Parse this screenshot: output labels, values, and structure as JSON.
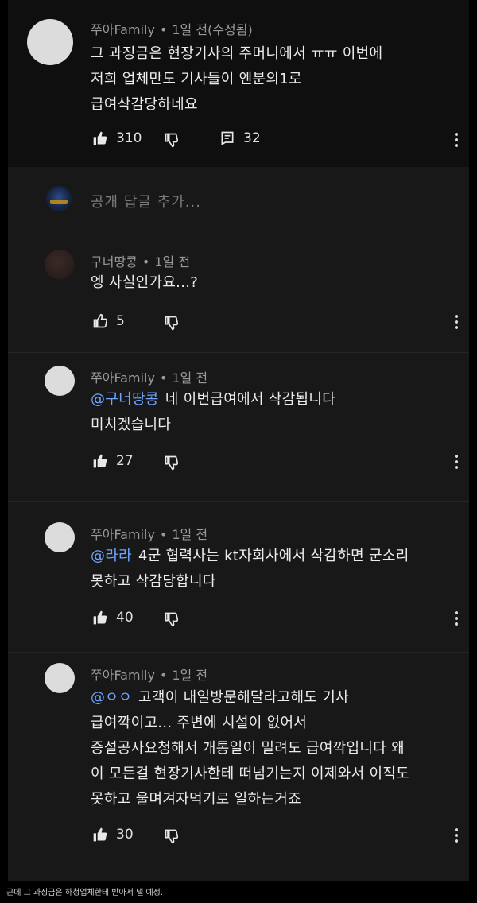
{
  "top_comment": {
    "author": "쭈아Family",
    "time": "1일 전(수정됨)",
    "lines": [
      "그 과징금은 현장기사의 주머니에서 ㅠㅠ 이번에",
      "저희 업체만도 기사들이 엔분의1로",
      "급여삭감당하네요"
    ],
    "likes": "310",
    "replies": "32"
  },
  "reply_box": {
    "placeholder": "공개 답글 추가..."
  },
  "replies": [
    {
      "author": "구너땅콩",
      "time": "1일 전",
      "mention": "",
      "lines": [
        "엥 사실인가요...?"
      ],
      "likes": "5"
    },
    {
      "author": "쭈아Family",
      "time": "1일 전",
      "mention": "@구너땅콩",
      "lines": [
        "네 이번급여에서 삭감됩니다",
        "미치겠습니다"
      ],
      "likes": "27"
    },
    {
      "author": "쭈아Family",
      "time": "1일 전",
      "mention": "@라라",
      "lines": [
        "4군 협력사는 kt자회사에서 삭감하면 군소리",
        "못하고 삭감당합니다"
      ],
      "likes": "40"
    },
    {
      "author": "쭈아Family",
      "time": "1일 전",
      "mention": "@ㅇㅇ",
      "lines": [
        "고객이 내일방문해달라고해도 기사",
        "급여깍이고... 주변에 시설이 없어서",
        "증설공사요청해서 개통일이 밀려도 급여깍입니다 왜",
        "이 모든걸 현장기사한테 떠넘기는지 이제와서 이직도",
        "못하고 울며겨자먹기로 일하는거죠"
      ],
      "likes": "30"
    }
  ],
  "caption": "근데 그 과징금은 하청업체한테 받아서 낼 예정."
}
